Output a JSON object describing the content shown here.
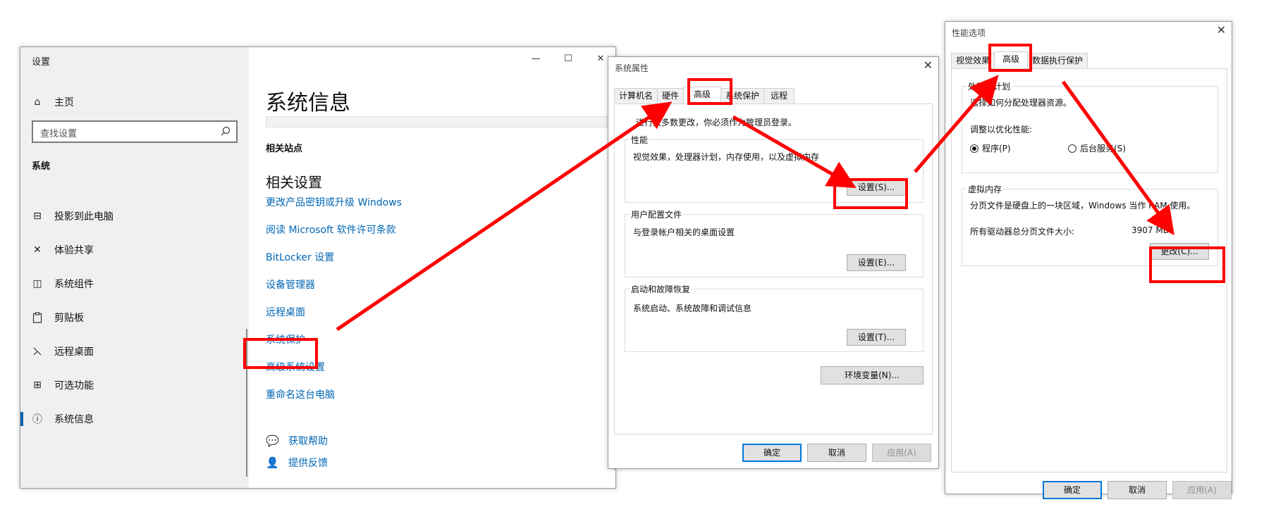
{
  "settings_window": {
    "title": "设置",
    "controls": {
      "minimize": "—",
      "maximize": "☐",
      "close": "✕"
    },
    "home": "主页",
    "search_placeholder": "查找设置",
    "section": "系统",
    "nav": [
      {
        "label": "投影到此电脑",
        "icon": "projector-icon",
        "glyph": "⊟"
      },
      {
        "label": "体验共享",
        "icon": "share-experience-icon",
        "glyph": "✕"
      },
      {
        "label": "系统组件",
        "icon": "components-icon",
        "glyph": "◫"
      },
      {
        "label": "剪贴板",
        "icon": "clipboard-icon",
        "glyph": "📋"
      },
      {
        "label": "远程桌面",
        "icon": "remote-desktop-icon",
        "glyph": "✕"
      },
      {
        "label": "可选功能",
        "icon": "optional-features-icon",
        "glyph": "⊞"
      },
      {
        "label": "系统信息",
        "icon": "info-icon",
        "glyph": "ⓘ",
        "active": true
      }
    ],
    "page_title": "系统信息",
    "related_sites": "相关站点",
    "related_settings": "相关设置",
    "links": [
      "更改产品密钥或升级 Windows",
      "阅读 Microsoft 软件许可条款",
      "BitLocker 设置",
      "设备管理器",
      "远程桌面",
      "系统保护",
      "高级系统设置",
      "重命名这台电脑"
    ],
    "help": {
      "get_help": "获取帮助",
      "feedback": "提供反馈"
    }
  },
  "system_properties": {
    "title": "系统属性",
    "close": "✕",
    "tabs": [
      "计算机名",
      "硬件",
      "高级",
      "系统保护",
      "远程"
    ],
    "selected_tab": "高级",
    "admin_note": "进行大多数更改，你必须作为管理员登录。",
    "groups": {
      "performance": {
        "label": "性能",
        "desc": "视觉效果，处理器计划，内存使用，以及虚拟内存",
        "button": "设置(S)..."
      },
      "user_profiles": {
        "label": "用户配置文件",
        "desc": "与登录帐户相关的桌面设置",
        "button": "设置(E)..."
      },
      "startup": {
        "label": "启动和故障恢复",
        "desc": "系统启动、系统故障和调试信息",
        "button": "设置(T)..."
      }
    },
    "env_button": "环境变量(N)...",
    "ok": "确定",
    "cancel": "取消",
    "apply": "应用(A)"
  },
  "performance_options": {
    "title": "性能选项",
    "close": "✕",
    "tabs": [
      "视觉效果",
      "高级",
      "数据执行保护"
    ],
    "selected_tab": "高级",
    "scheduler": {
      "label": "处理器计划",
      "desc": "选择如何分配处理器资源。",
      "optimize_label": "调整以优化性能:",
      "options": [
        {
          "label": "程序(P)",
          "checked": true
        },
        {
          "label": "后台服务(S)",
          "checked": false
        }
      ]
    },
    "virtual_memory": {
      "label": "虚拟内存",
      "desc": "分页文件是硬盘上的一块区域，Windows 当作 RAM 使用。",
      "total_label": "所有驱动器总分页文件大小:",
      "total_value": "3907 MB",
      "change_button": "更改(C)..."
    },
    "ok": "确定",
    "cancel": "取消",
    "apply": "应用(A)"
  },
  "annotation_color": "#ff0000"
}
